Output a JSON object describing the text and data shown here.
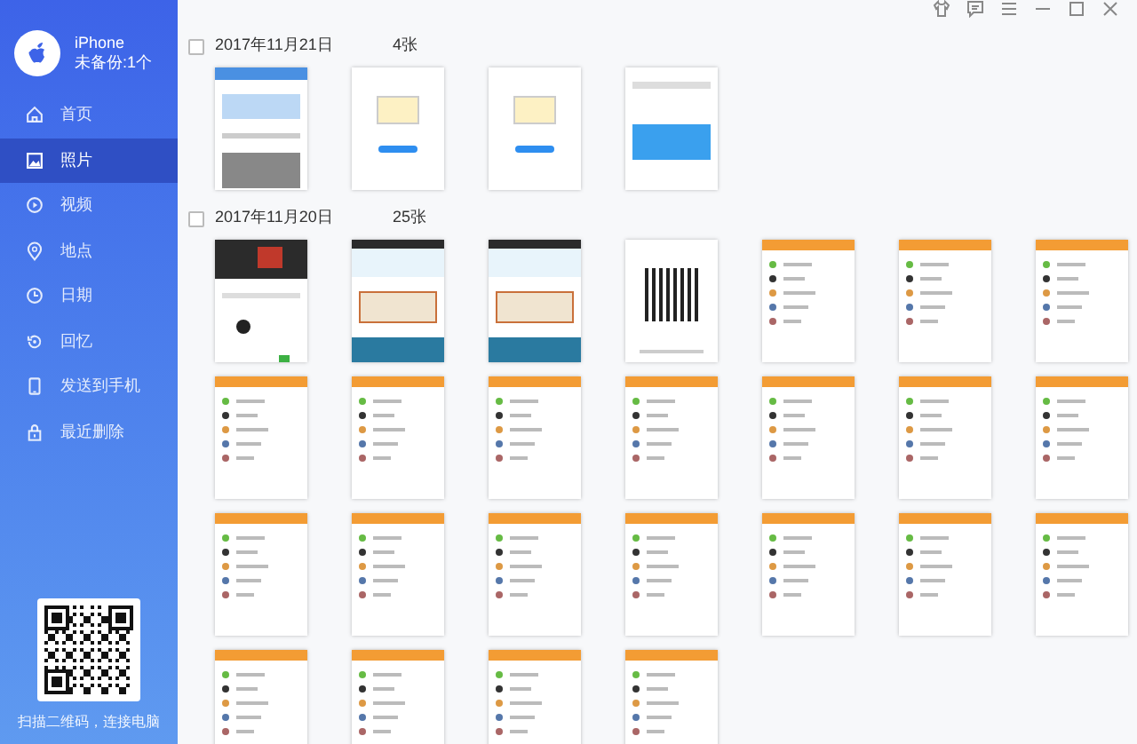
{
  "device": {
    "name": "iPhone",
    "backup_status": "未备份:1个"
  },
  "sidebar": {
    "items": [
      {
        "label": "首页",
        "selected": false
      },
      {
        "label": "照片",
        "selected": true
      },
      {
        "label": "视频",
        "selected": false
      },
      {
        "label": "地点",
        "selected": false
      },
      {
        "label": "日期",
        "selected": false
      },
      {
        "label": "回忆",
        "selected": false
      },
      {
        "label": "发送到手机",
        "selected": false
      },
      {
        "label": "最近删除",
        "selected": false
      }
    ]
  },
  "qr_caption": "扫描二维码，连接电脑",
  "groups": [
    {
      "date": "2017年11月21日",
      "count": "4张",
      "checked": false,
      "photos": [
        {
          "kind": "app"
        },
        {
          "kind": "welcome"
        },
        {
          "kind": "welcome"
        },
        {
          "kind": "dashboard"
        }
      ]
    },
    {
      "date": "2017年11月20日",
      "count": "25张",
      "checked": false,
      "photos": [
        {
          "kind": "dark"
        },
        {
          "kind": "article"
        },
        {
          "kind": "article"
        },
        {
          "kind": "qr"
        },
        {
          "kind": "chat"
        },
        {
          "kind": "chat"
        },
        {
          "kind": "chat"
        },
        {
          "kind": "chat"
        },
        {
          "kind": "chat"
        },
        {
          "kind": "chat"
        },
        {
          "kind": "chat"
        },
        {
          "kind": "chat"
        },
        {
          "kind": "chat"
        },
        {
          "kind": "chat"
        },
        {
          "kind": "chat"
        },
        {
          "kind": "chat"
        },
        {
          "kind": "chat"
        },
        {
          "kind": "chat"
        },
        {
          "kind": "chat"
        },
        {
          "kind": "chat"
        },
        {
          "kind": "chat"
        },
        {
          "kind": "chat"
        },
        {
          "kind": "chat"
        },
        {
          "kind": "chat"
        },
        {
          "kind": "chat"
        }
      ]
    }
  ]
}
